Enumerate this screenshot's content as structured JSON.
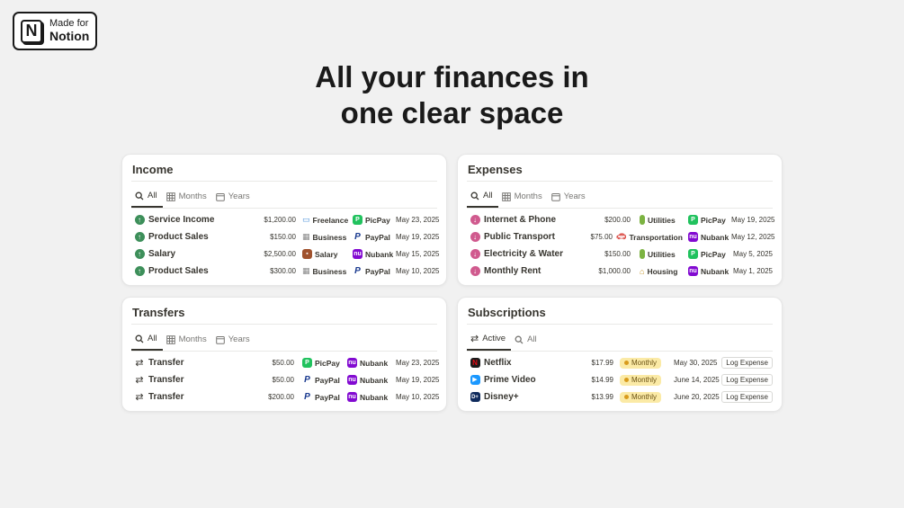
{
  "badge": {
    "line1": "Made for",
    "line2": "Notion",
    "logo_letter": "N"
  },
  "headline": {
    "line1": "All your finances in",
    "line2": "one clear space"
  },
  "colors": {
    "income_icon": "#3d8f5a",
    "expense_icon": "#d05a8e",
    "picpay": "#21c25e",
    "paypal": "#1a3a8f",
    "nubank": "#820ad1",
    "monthly_pill": "#fbeaa6"
  },
  "income": {
    "title": "Income",
    "tabs": [
      "All",
      "Months",
      "Years"
    ],
    "rows": [
      {
        "name": "Service Income",
        "amount": "$1,200.00",
        "category": "Freelance",
        "category_icon": "computer-icon",
        "account": "PicPay",
        "date": "May 23, 2025"
      },
      {
        "name": "Product Sales",
        "amount": "$150.00",
        "category": "Business",
        "category_icon": "building-icon",
        "account": "PayPal",
        "date": "May 19, 2025"
      },
      {
        "name": "Salary",
        "amount": "$2,500.00",
        "category": "Salary",
        "category_icon": "briefcase-icon",
        "account": "Nubank",
        "date": "May 15, 2025"
      },
      {
        "name": "Product Sales",
        "amount": "$300.00",
        "category": "Business",
        "category_icon": "building-icon",
        "account": "PayPal",
        "date": "May 10, 2025"
      }
    ]
  },
  "expenses": {
    "title": "Expenses",
    "tabs": [
      "All",
      "Months",
      "Years"
    ],
    "rows": [
      {
        "name": "Internet & Phone",
        "amount": "$200.00",
        "category": "Utilities",
        "category_icon": "battery-icon",
        "account": "PicPay",
        "date": "May 19, 2025"
      },
      {
        "name": "Public Transport",
        "amount": "$75.00",
        "category": "Transportation",
        "category_icon": "car-icon",
        "account": "Nubank",
        "date": "May 12, 2025"
      },
      {
        "name": "Electricity & Water",
        "amount": "$150.00",
        "category": "Utilities",
        "category_icon": "battery-icon",
        "account": "PicPay",
        "date": "May 5, 2025"
      },
      {
        "name": "Monthly Rent",
        "amount": "$1,000.00",
        "category": "Housing",
        "category_icon": "house-icon",
        "account": "Nubank",
        "date": "May 1, 2025"
      }
    ]
  },
  "transfers": {
    "title": "Transfers",
    "tabs": [
      "All",
      "Months",
      "Years"
    ],
    "rows": [
      {
        "name": "Transfer",
        "amount": "$50.00",
        "from": "PicPay",
        "to": "Nubank",
        "date": "May 23, 2025"
      },
      {
        "name": "Transfer",
        "amount": "$50.00",
        "from": "PayPal",
        "to": "Nubank",
        "date": "May 19, 2025"
      },
      {
        "name": "Transfer",
        "amount": "$200.00",
        "from": "PayPal",
        "to": "Nubank",
        "date": "May 10, 2025"
      }
    ]
  },
  "subscriptions": {
    "title": "Subscriptions",
    "tabs": [
      "Active",
      "All"
    ],
    "rows": [
      {
        "name": "Netflix",
        "amount": "$17.99",
        "frequency": "Monthly",
        "date": "May 30, 2025",
        "action": "Log Expense",
        "icon": "netflix-icon"
      },
      {
        "name": "Prime Video",
        "amount": "$14.99",
        "frequency": "Monthly",
        "date": "June 14, 2025",
        "action": "Log Expense",
        "icon": "prime-video-icon"
      },
      {
        "name": "Disney+",
        "amount": "$13.99",
        "frequency": "Monthly",
        "date": "June 20, 2025",
        "action": "Log Expense",
        "icon": "disney-plus-icon"
      }
    ]
  }
}
